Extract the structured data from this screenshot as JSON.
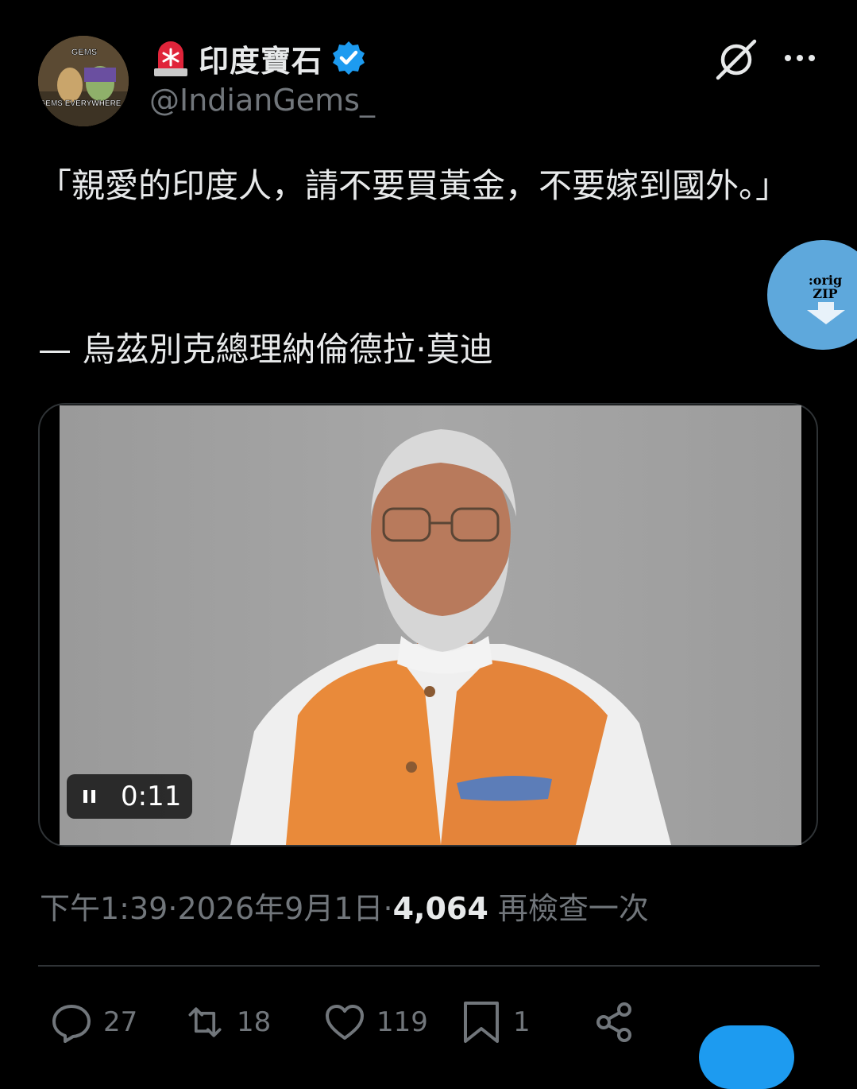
{
  "author": {
    "display_name": "印度寶石",
    "handle": "@IndianGems_",
    "avatar_text_top": "GEMS",
    "avatar_text_bottom": "GEMS EVERYWHERE",
    "verified": true,
    "badge_color": "#1d9bf0"
  },
  "tweet": {
    "text": "「親愛的印度人，請不要買黃金，不要嫁到國外。」",
    "attribution": "— 烏茲別克總理納倫德拉·莫迪"
  },
  "video": {
    "time": "0:11",
    "state": "playing"
  },
  "zip_button": {
    "line1": ":orig",
    "line2": "ZIP"
  },
  "meta": {
    "time": "下午1:39",
    "separator": " · ",
    "date": "2026年9月1日",
    "views": "4,064",
    "views_label": "再檢查一次"
  },
  "actions": {
    "replies": "27",
    "reposts": "18",
    "likes": "119",
    "bookmarks": "1"
  },
  "icons": {
    "more": "more-icon",
    "grok": "grok-icon",
    "reply": "reply-icon",
    "repost": "repost-icon",
    "like": "heart-icon",
    "bookmark": "bookmark-icon",
    "share": "share-icon"
  }
}
